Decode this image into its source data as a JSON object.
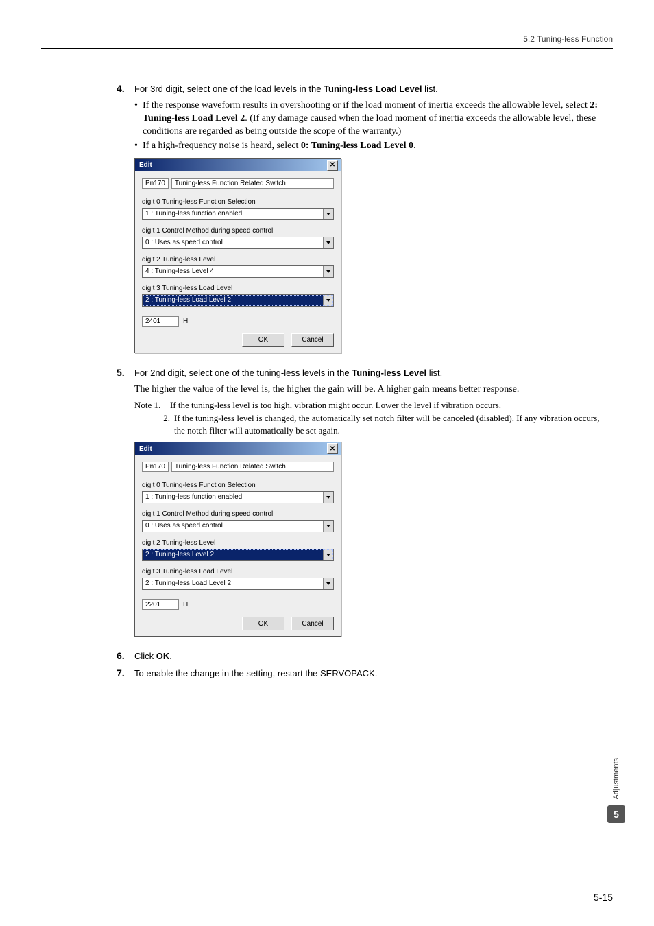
{
  "header": {
    "section": "5.2  Tuning-less Function"
  },
  "steps": {
    "s4": {
      "num": "4.",
      "lead_a": "For 3rd digit, select one of the load levels in the ",
      "lead_b": "Tuning-less Load Level",
      "lead_c": " list.",
      "bullet1_a": "If the response waveform results in overshooting or if the load moment of inertia exceeds the allowable level, select ",
      "bullet1_b": "2: Tuning-less Load Level 2",
      "bullet1_c": ". (If any damage caused when the load moment of inertia exceeds the allowable level, these conditions are regarded as being outside the scope of the warranty.)",
      "bullet2_a": "If a high-frequency noise is heard, select ",
      "bullet2_b": "0: Tuning-less Load Level 0",
      "bullet2_c": "."
    },
    "s5": {
      "num": "5.",
      "lead_a": "For 2nd digit, select one of the tuning-less levels in the ",
      "lead_b": "Tuning-less Level",
      "lead_c": " list.",
      "para1": "The higher the value of the level is, the higher the gain will be. A higher gain means better response.",
      "note1_label": "Note 1.",
      "note1_body": "If the tuning-less level is too high, vibration might occur. Lower the level if vibration occurs.",
      "note2_label": "2.",
      "note2_body": "If the tuning-less level is changed, the automatically set notch filter will be canceled (disabled). If any vibration occurs, the notch filter will automatically be set again."
    },
    "s6": {
      "num": "6.",
      "lead_a": "Click ",
      "lead_b": "OK",
      "lead_c": "."
    },
    "s7": {
      "num": "7.",
      "lead": "To enable the change in the setting, restart the SERVOPACK."
    }
  },
  "dialog1": {
    "title": "Edit",
    "pn_code": "Pn170",
    "pn_name": "Tuning-less Function Related Switch",
    "d0_label": "digit 0  Tuning-less Function Selection",
    "d0_value": "1 : Tuning-less function enabled",
    "d1_label": "digit 1  Control Method during speed control",
    "d1_value": "0 : Uses as speed control",
    "d2_label": "digit 2  Tuning-less Level",
    "d2_value": "4 : Tuning-less Level 4",
    "d3_label": "digit 3  Tuning-less Load Level",
    "d3_value": "2 : Tuning-less Load Level 2",
    "val": "2401",
    "unit": "H",
    "ok": "OK",
    "cancel": "Cancel"
  },
  "dialog2": {
    "title": "Edit",
    "pn_code": "Pn170",
    "pn_name": "Tuning-less Function Related Switch",
    "d0_label": "digit 0  Tuning-less Function Selection",
    "d0_value": "1 : Tuning-less function enabled",
    "d1_label": "digit 1  Control Method during speed control",
    "d1_value": "0 : Uses as speed control",
    "d2_label": "digit 2  Tuning-less Level",
    "d2_value": "2 : Tuning-less Level 2",
    "d3_label": "digit 3  Tuning-less Load Level",
    "d3_value": "2 : Tuning-less Load Level 2",
    "val": "2201",
    "unit": "H",
    "ok": "OK",
    "cancel": "Cancel"
  },
  "side": {
    "label": "Adjustments",
    "badge": "5"
  },
  "pagenum": "5-15"
}
